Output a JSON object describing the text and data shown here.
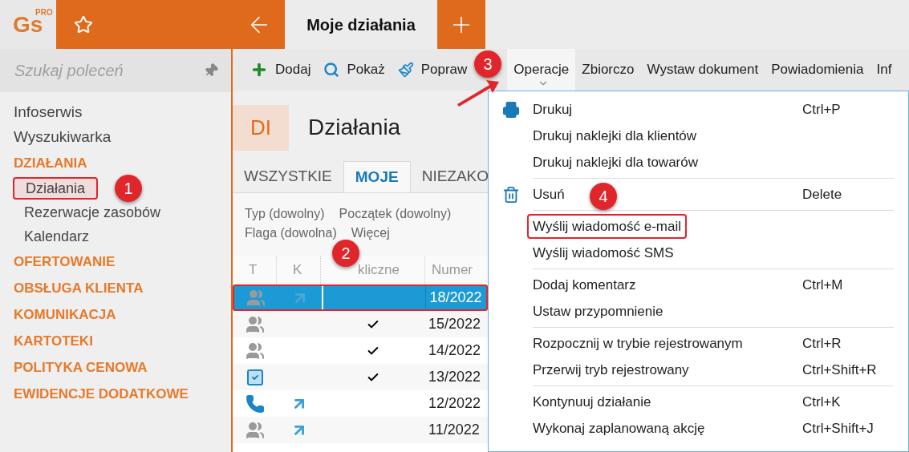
{
  "app": {
    "logo": "Gs",
    "logo_tag": "PRO"
  },
  "tabs": [
    {
      "label": "Moje działania",
      "selected": true
    }
  ],
  "sidebar": {
    "search": {
      "placeholder": "Szukaj poleceń"
    },
    "items": [
      {
        "label": "Infoserwis",
        "kind": "link"
      },
      {
        "label": "Wyszukiwarka",
        "kind": "link"
      },
      {
        "label": "DZIAŁANIA",
        "kind": "section",
        "children": [
          {
            "label": "Działania",
            "selected": true
          },
          {
            "label": "Rezerwacje zasobów",
            "selected": false
          },
          {
            "label": "Kalendarz",
            "selected": false
          }
        ]
      },
      {
        "label": "OFERTOWANIE",
        "kind": "section"
      },
      {
        "label": "OBSŁUGA KLIENTA",
        "kind": "section"
      },
      {
        "label": "KOMUNIKACJA",
        "kind": "section"
      },
      {
        "label": "KARTOTEKI",
        "kind": "section"
      },
      {
        "label": "POLITYKA CENOWA",
        "kind": "section"
      },
      {
        "label": "EWIDENCJE DODATKOWE",
        "kind": "section"
      }
    ]
  },
  "toolbar": [
    {
      "label": "Dodaj",
      "kind": "add",
      "selected": false
    },
    {
      "label": "Pokaż",
      "kind": "search",
      "selected": false
    },
    {
      "label": "Popraw",
      "kind": "edit",
      "selected": false
    },
    {
      "label": "Operacje",
      "kind": "dropdown",
      "selected": true
    },
    {
      "label": "Zbiorczo",
      "kind": "plain",
      "selected": false
    },
    {
      "label": "Wystaw dokument",
      "kind": "plain",
      "selected": false
    },
    {
      "label": "Powiadomienia",
      "kind": "plain",
      "selected": false
    },
    {
      "label": "Inf",
      "kind": "plain",
      "selected": false
    }
  ],
  "header": {
    "badge": "DI",
    "title": "Działania"
  },
  "view_tabs": [
    {
      "label": "WSZYSTKIE",
      "selected": false
    },
    {
      "label": "MOJE",
      "selected": true
    },
    {
      "label": "NIEZAKO",
      "selected": false
    }
  ],
  "filters": [
    [
      "Typ (dowolny)",
      "Początek (dowolny)"
    ],
    [
      "Flaga (dowolna)",
      "Więcej"
    ]
  ],
  "table": {
    "columns": [
      "T",
      "K",
      "kliczne",
      "Numer"
    ],
    "rows": [
      {
        "kind": "group",
        "linked": true,
        "cyclic": false,
        "number": "18/2022",
        "selected": true
      },
      {
        "kind": "group",
        "linked": false,
        "cyclic": true,
        "number": "15/2022",
        "selected": false
      },
      {
        "kind": "group",
        "linked": false,
        "cyclic": true,
        "number": "14/2022",
        "selected": false
      },
      {
        "kind": "task",
        "linked": false,
        "cyclic": true,
        "number": "13/2022",
        "selected": false
      },
      {
        "kind": "phone",
        "linked": true,
        "cyclic": false,
        "number": "12/2022",
        "selected": false
      },
      {
        "kind": "group",
        "linked": true,
        "cyclic": false,
        "number": "11/2022",
        "selected": false
      }
    ]
  },
  "menu": {
    "groups": [
      [
        {
          "label": "Drukuj",
          "kind": "printer",
          "shortcut": "Ctrl+P",
          "highlighted": false
        },
        {
          "label": "Drukuj naklejki dla klientów",
          "highlighted": false
        },
        {
          "label": "Drukuj naklejki dla towarów",
          "highlighted": false
        }
      ],
      [
        {
          "label": "Usuń",
          "kind": "trash",
          "shortcut": "Delete",
          "highlighted": false
        }
      ],
      [
        {
          "label": "Wyślij wiadomość e-mail",
          "highlighted": true
        },
        {
          "label": "Wyślij wiadomość SMS",
          "highlighted": false
        }
      ],
      [
        {
          "label": "Dodaj komentarz",
          "shortcut": "Ctrl+M",
          "highlighted": false
        },
        {
          "label": "Ustaw przypomnienie",
          "highlighted": false
        }
      ],
      [
        {
          "label": "Rozpocznij w trybie rejestrowanym",
          "shortcut": "Ctrl+R",
          "highlighted": false
        },
        {
          "label": "Przerwij tryb rejestrowany",
          "shortcut": "Ctrl+Shift+R",
          "highlighted": false
        }
      ],
      [
        {
          "label": "Kontynuuj działanie",
          "shortcut": "Ctrl+K",
          "highlighted": false
        },
        {
          "label": "Wykonaj zaplanowaną akcję",
          "shortcut": "Ctrl+Shift+J",
          "highlighted": false
        }
      ]
    ]
  },
  "annotations": [
    "1",
    "2",
    "3",
    "4"
  ]
}
